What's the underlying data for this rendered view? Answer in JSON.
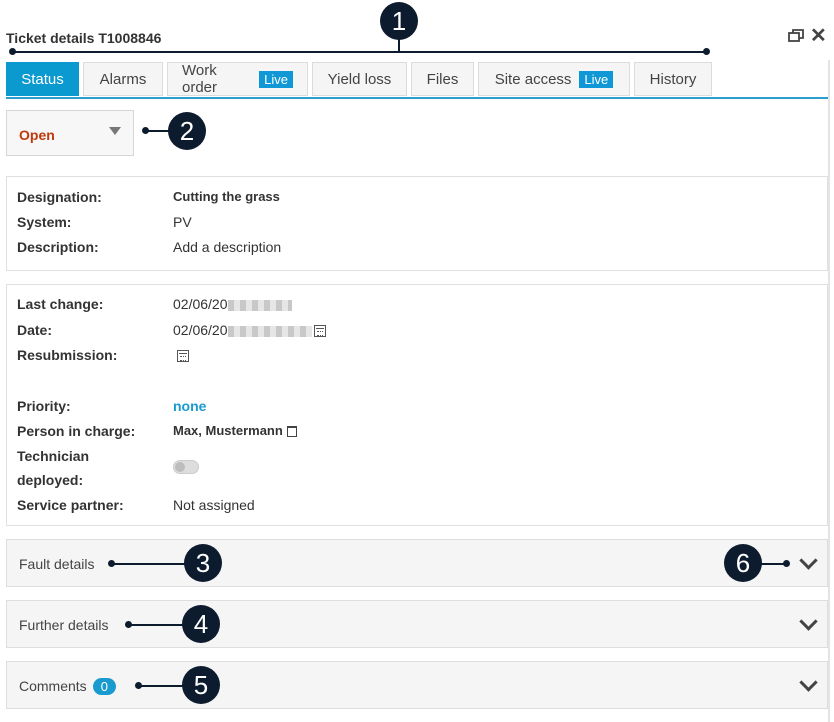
{
  "header": {
    "title": "Ticket details T1008846"
  },
  "tabs": [
    {
      "label": "Status",
      "badge": ""
    },
    {
      "label": "Alarms",
      "badge": ""
    },
    {
      "label": "Work order",
      "badge": "Live"
    },
    {
      "label": "Yield loss",
      "badge": ""
    },
    {
      "label": "Files",
      "badge": ""
    },
    {
      "label": "Site access",
      "badge": "Live"
    },
    {
      "label": "History",
      "badge": ""
    }
  ],
  "status": {
    "value": "Open"
  },
  "info": {
    "designation_label": "Designation:",
    "designation": "Cutting the grass",
    "system_label": "System:",
    "system": "PV",
    "description_label": "Description:",
    "description": "Add a description"
  },
  "details": {
    "last_change_label": "Last change:",
    "last_change": "02/06/20",
    "date_label": "Date:",
    "date": "02/06/20",
    "resubmission_label": "Resubmission:",
    "priority_label": "Priority:",
    "priority": "none",
    "person_label": "Person in charge:",
    "person": "Max, Mustermann",
    "technician_label_1": "Technician",
    "technician_label_2": "deployed:",
    "technician_deployed": false,
    "partner_label": "Service partner:",
    "partner": "Not assigned"
  },
  "accordions": [
    {
      "label": "Fault details"
    },
    {
      "label": "Further details"
    },
    {
      "label": "Comments",
      "count": "0"
    }
  ],
  "callouts": [
    "1",
    "2",
    "3",
    "4",
    "5",
    "6"
  ],
  "colors": {
    "accent": "#0a9ad0",
    "status_open": "#c0390b",
    "callout": "#0d1b2e"
  }
}
